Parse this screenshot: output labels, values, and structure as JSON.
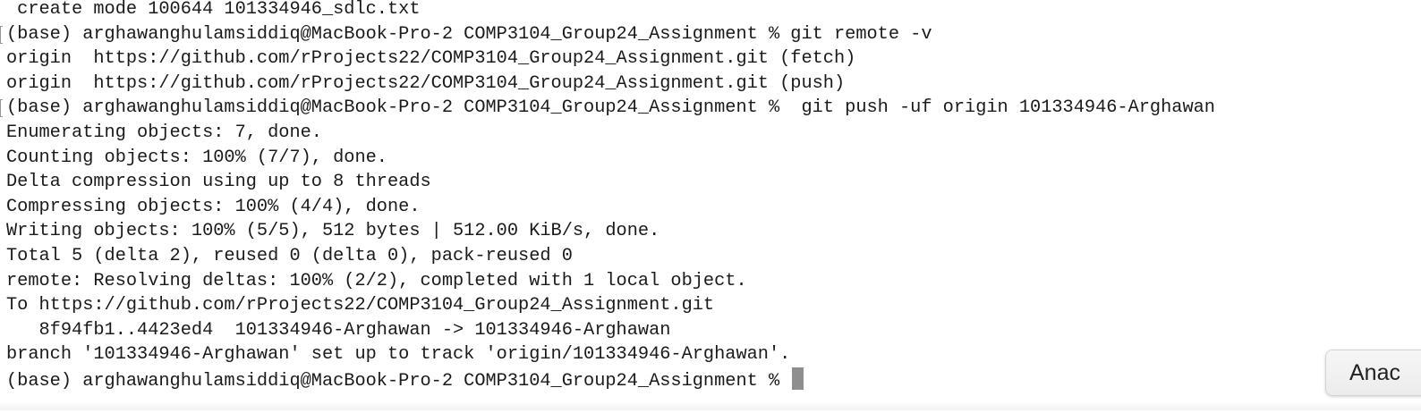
{
  "terminal": {
    "lines": [
      {
        "text": " create mode 100644 101334946_sdlc.txt",
        "marked": false
      },
      {
        "text": "(base) arghawanghulamsiddiq@MacBook-Pro-2 COMP3104_Group24_Assignment % git remote -v",
        "marked": true
      },
      {
        "text": "origin  https://github.com/rProjects22/COMP3104_Group24_Assignment.git (fetch)",
        "marked": false
      },
      {
        "text": "origin  https://github.com/rProjects22/COMP3104_Group24_Assignment.git (push)",
        "marked": false
      },
      {
        "text": "(base) arghawanghulamsiddiq@MacBook-Pro-2 COMP3104_Group24_Assignment %  git push -uf origin 101334946-Arghawan",
        "marked": true
      },
      {
        "text": "Enumerating objects: 7, done.",
        "marked": false
      },
      {
        "text": "Counting objects: 100% (7/7), done.",
        "marked": false
      },
      {
        "text": "Delta compression using up to 8 threads",
        "marked": false
      },
      {
        "text": "Compressing objects: 100% (4/4), done.",
        "marked": false
      },
      {
        "text": "Writing objects: 100% (5/5), 512 bytes | 512.00 KiB/s, done.",
        "marked": false
      },
      {
        "text": "Total 5 (delta 2), reused 0 (delta 0), pack-reused 0",
        "marked": false
      },
      {
        "text": "remote: Resolving deltas: 100% (2/2), completed with 1 local object.",
        "marked": false
      },
      {
        "text": "To https://github.com/rProjects22/COMP3104_Group24_Assignment.git",
        "marked": false
      },
      {
        "text": "   8f94fb1..4423ed4  101334946-Arghawan -> 101334946-Arghawan",
        "marked": false
      },
      {
        "text": "branch '101334946-Arghawan' set up to track 'origin/101334946-Arghawan'.",
        "marked": false
      }
    ],
    "prompt": "(base) arghawanghulamsiddiq@MacBook-Pro-2 COMP3104_Group24_Assignment % ",
    "colors": {
      "background": "#ffffff",
      "text": "#1a1a1a",
      "cursor": "#8e8e8e"
    }
  },
  "side_button": {
    "label": "Anac"
  }
}
